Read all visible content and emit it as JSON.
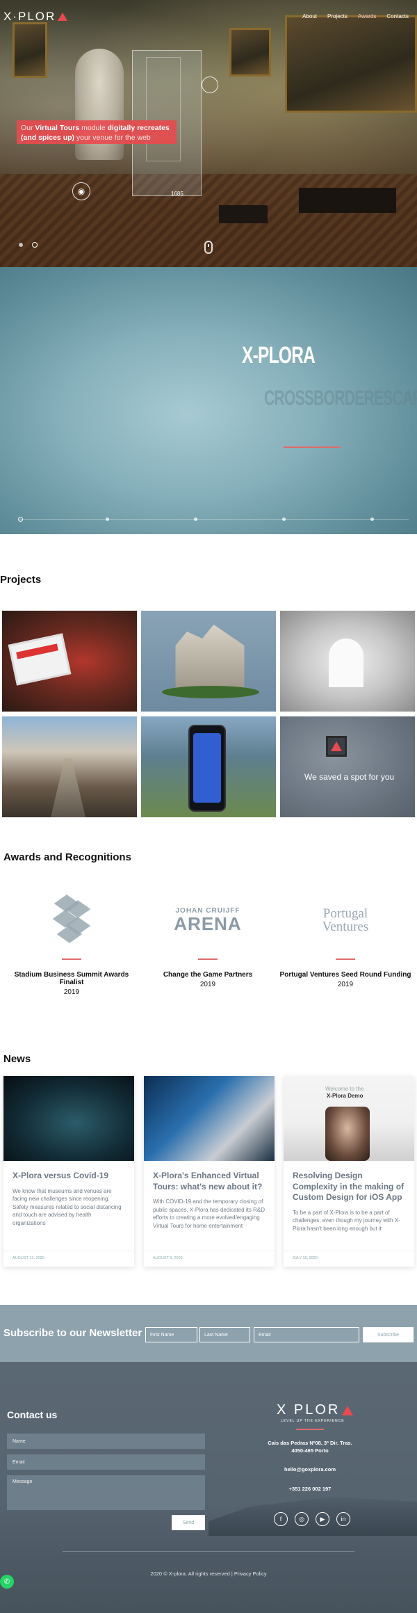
{
  "header": {
    "logo_text": "X·PLOR",
    "nav": [
      "About",
      "Projects",
      "Awards",
      "Contacts"
    ],
    "active_nav": "Awards"
  },
  "hero": {
    "cta_pre": "Our ",
    "cta_bold1": "Virtual Tours",
    "cta_mid": " module ",
    "cta_bold2": "digitally recreates",
    "cta_bold3": "(and spices up)",
    "cta_post": " your venue for the web",
    "hotspot_label": "1685",
    "slides": 2,
    "active_slide": 2
  },
  "video": {
    "brand": "X-PLORA",
    "ghost_text": "CROSSBORDERESCAPE",
    "timeline_points": 5,
    "active_point": 1
  },
  "projects": {
    "title": "Projects",
    "tiles": [
      {
        "name": "tablet-football",
        "caption": ""
      },
      {
        "name": "ruin-3d",
        "caption": ""
      },
      {
        "name": "white-gallery",
        "caption": ""
      },
      {
        "name": "porto-street",
        "caption": ""
      },
      {
        "name": "football-app",
        "caption": ""
      },
      {
        "name": "placeholder-spot",
        "caption": "We saved a spot for you"
      }
    ]
  },
  "awards": {
    "title": "Awards and Recognitions",
    "items": [
      {
        "logo": "cubes-icon",
        "name": "Stadium Business Summit Awards Finalist",
        "year": "2019"
      },
      {
        "logo_top": "JOHAN CRUIJFF",
        "logo_bottom": "ARENA",
        "name": "Change the Game Partners",
        "year": "2019"
      },
      {
        "logo_top": "Portugal",
        "logo_bottom": "Ventures",
        "name": "Portugal Ventures Seed Round Funding",
        "year": "2019"
      }
    ]
  },
  "news": {
    "title": "News",
    "items": [
      {
        "title": "X-Plora versus Covid-19",
        "excerpt": "We know that museums and venues are facing new challenges since reopening. Safety measures related to social distancing and touch are advised by health organizations",
        "date": "AUGUST 13, 2020"
      },
      {
        "title": "X-Plora's Enhanced Virtual Tours: what's new about it?",
        "excerpt": "With COVID-19 and the temporary closing of public spaces, X-Plora has dedicated its R&D efforts to creating a more evolved/engaging Virtual Tours for home entertainment",
        "date": "AUGUST 5, 2020"
      },
      {
        "title": "Resolving Design Complexity in the making of Custom Design for iOS App",
        "excerpt": "To be a part of X-Plora is to be a part of challenges, even though my journey with X-Plora hasn't been long enough but it",
        "date": "JULY 15, 2020",
        "img_text1": "Welcome to the",
        "img_text2": "X-Plora Demo"
      }
    ]
  },
  "newsletter": {
    "title": "Subscribe to our Newsletter",
    "first_name_placeholder": "First Name",
    "last_name_placeholder": "Last Name",
    "email_placeholder": "Email",
    "button": "Subscribe"
  },
  "contact": {
    "title": "Contact us",
    "name_placeholder": "Name",
    "email_placeholder": "Email",
    "message_placeholder": "Message",
    "send_button": "Send",
    "logo_text": "X PLOR",
    "tagline": "LEVEL UP THE EXPERIENCE",
    "address_line1": "Cais das Pedras Nº08, 3º Dir. Tras.",
    "address_line2": "4050-465 Porto",
    "email": "hello@goxplora.com",
    "phone": "+351 226 002 197",
    "social": [
      "facebook-icon",
      "instagram-icon",
      "youtube-icon",
      "linkedin-icon"
    ],
    "copyright": "2020 © X-plora. All rights reserved |",
    "privacy": "Privacy Policy"
  },
  "colors": {
    "accent": "#e94a4f",
    "newsletter_bg": "#8da2ad",
    "footer_bg": "#566470",
    "whatsapp": "#25d366"
  }
}
